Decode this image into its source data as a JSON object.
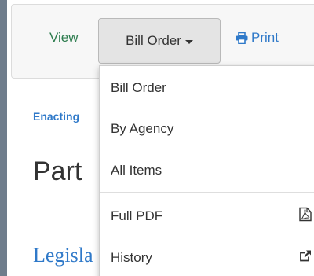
{
  "toolbar": {
    "view_label": "View",
    "order_button_label": "Bill Order",
    "print_label": "Print"
  },
  "background": {
    "link1": "Enacting",
    "heading": "Part",
    "link2": "Legisla"
  },
  "menu": {
    "items": [
      {
        "label": "Bill Order"
      },
      {
        "label": "By Agency"
      },
      {
        "label": "All Items"
      },
      {
        "label": "Full PDF",
        "icon": "pdf-icon"
      },
      {
        "label": "History",
        "icon": "external-link-icon"
      }
    ]
  },
  "colors": {
    "accent": "#2f79c9",
    "view_green": "#2e7d4f",
    "frame": "#6f7d8c"
  }
}
